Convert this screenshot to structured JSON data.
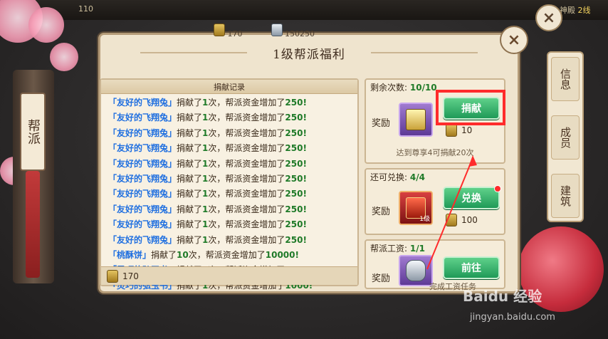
{
  "top_stats": {
    "left_value": "110",
    "right_label": "神殿",
    "right_value": "2线"
  },
  "currency": {
    "coin": "170",
    "silver": "150250"
  },
  "dialog": {
    "title": "1级帮派福利",
    "close_label": "×"
  },
  "outer_close_label": "×",
  "left_tab_label": "帮派",
  "side_tabs": [
    {
      "label": "信息"
    },
    {
      "label": "成员"
    },
    {
      "label": "建筑"
    }
  ],
  "log": {
    "header": "捐献记录",
    "items": [
      {
        "name": "「友好的飞翔兔」",
        "verb": "捐献了",
        "times": "1",
        "unit": "次，帮派资金增加了",
        "gain": "250!"
      },
      {
        "name": "「友好的飞翔兔」",
        "verb": "捐献了",
        "times": "1",
        "unit": "次，帮派资金增加了",
        "gain": "250!"
      },
      {
        "name": "「友好的飞翔兔」",
        "verb": "捐献了",
        "times": "1",
        "unit": "次，帮派资金增加了",
        "gain": "250!"
      },
      {
        "name": "「友好的飞翔兔」",
        "verb": "捐献了",
        "times": "1",
        "unit": "次，帮派资金增加了",
        "gain": "250!"
      },
      {
        "name": "「友好的飞翔兔」",
        "verb": "捐献了",
        "times": "1",
        "unit": "次，帮派资金增加了",
        "gain": "250!"
      },
      {
        "name": "「友好的飞翔兔」",
        "verb": "捐献了",
        "times": "1",
        "unit": "次，帮派资金增加了",
        "gain": "250!"
      },
      {
        "name": "「友好的飞翔兔」",
        "verb": "捐献了",
        "times": "1",
        "unit": "次，帮派资金增加了",
        "gain": "250!"
      },
      {
        "name": "「友好的飞翔兔」",
        "verb": "捐献了",
        "times": "1",
        "unit": "次，帮派资金增加了",
        "gain": "250!"
      },
      {
        "name": "「友好的飞翔兔」",
        "verb": "捐献了",
        "times": "1",
        "unit": "次，帮派资金增加了",
        "gain": "250!"
      },
      {
        "name": "「友好的飞翔兔」",
        "verb": "捐献了",
        "times": "1",
        "unit": "次，帮派资金增加了",
        "gain": "250!"
      },
      {
        "name": "「桃酥饼」",
        "verb": "捐献了",
        "times": "10",
        "unit": "次，帮派资金增加了",
        "gain": "10000!"
      },
      {
        "name": "「灵巧的弘玉书」",
        "verb": "捐献了",
        "times": "1",
        "unit": "次，帮派资金增加了",
        "gain": "1000!"
      },
      {
        "name": "「灵巧的弘玉书」",
        "verb": "捐献了",
        "times": "1",
        "unit": "次，帮派资金增加了",
        "gain": "1000!"
      }
    ],
    "footer_value": "170"
  },
  "donate_card": {
    "header_label": "剩余次数:",
    "header_count": "10/10",
    "reward_label": "奖励",
    "button_label": "捐献",
    "cost": "10",
    "note": "达到尊享4可捐献20次"
  },
  "exchange_card": {
    "header_label": "还可兑换:",
    "header_count": "4/4",
    "reward_label": "奖励",
    "button_label": "兑换",
    "cost": "100",
    "level_tag": "1级"
  },
  "salary_card": {
    "header_label": "帮派工资:",
    "header_count": "1/1",
    "reward_label": "奖励",
    "button_label": "前往",
    "note": "完成工资任务"
  },
  "watermark": {
    "text": "Baidu 经验",
    "sub": "jingyan.baidu.com"
  },
  "colors": {
    "dialog_bg": "#efe4ce",
    "player_name": "#1f6fe0",
    "count_green": "#1f7a28",
    "button_green": "#1f9a58",
    "highlight_red": "#ff2b2b"
  }
}
